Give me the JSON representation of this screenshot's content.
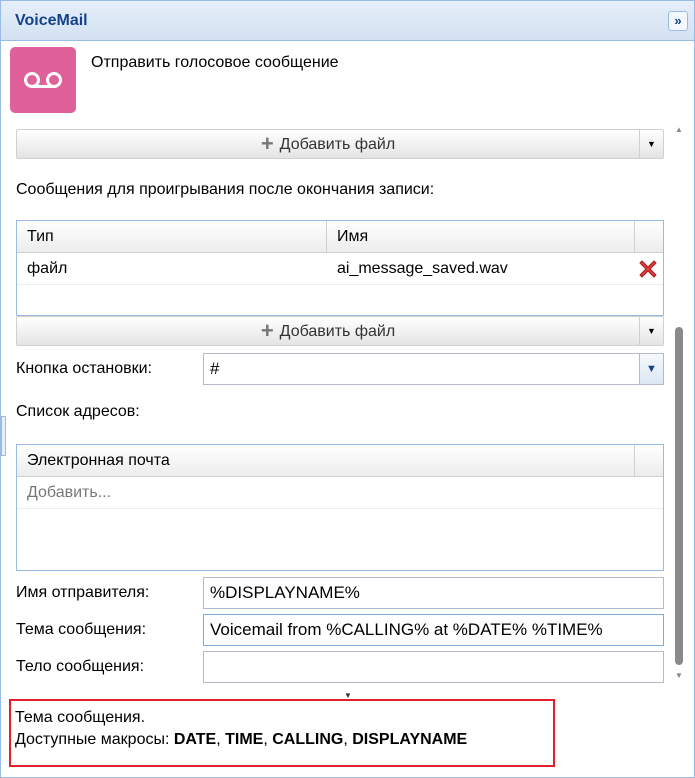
{
  "window": {
    "title": "VoiceMail",
    "collapse_icon": "double-chevron-right-icon"
  },
  "header": {
    "icon": "voicemail-icon",
    "icon_color": "#e0609a",
    "description": "Отправить голосовое сообщение"
  },
  "top_add_bar": {
    "label": "Добавить файл"
  },
  "playback": {
    "label": "Сообщения для проигрывания после окончания записи:",
    "columns": [
      "Тип",
      "Имя"
    ],
    "rows": [
      {
        "type": "файл",
        "name": "ai_message_saved.wav"
      }
    ],
    "add_label": "Добавить файл"
  },
  "stop_key": {
    "label": "Кнопка остановки:",
    "value": "#"
  },
  "address_list": {
    "label": "Список адресов:",
    "column": "Электронная почта",
    "add_placeholder": "Добавить..."
  },
  "sender": {
    "label": "Имя отправителя:",
    "value": "%DISPLAYNAME%"
  },
  "subject": {
    "label": "Тема сообщения:",
    "value": "Voicemail from %CALLING% at %DATE% %TIME%"
  },
  "body": {
    "label": "Тело сообщения:",
    "value": ""
  },
  "help": {
    "title": "Тема сообщения.",
    "macros_prefix": "Доступные макросы: ",
    "macros": [
      "DATE",
      "TIME",
      "CALLING",
      "DISPLAYNAME"
    ],
    "border_color": "#e0202c"
  }
}
